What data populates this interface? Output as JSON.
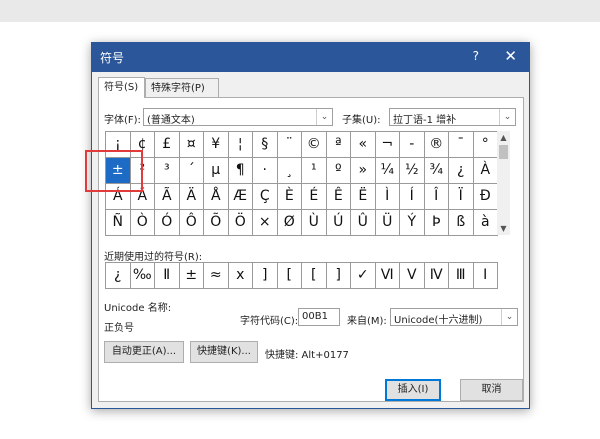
{
  "dialog": {
    "title": "符号",
    "help": "?",
    "close": "✕"
  },
  "tabs": [
    {
      "label": "符号(S)",
      "active": true
    },
    {
      "label": "特殊字符(P)",
      "active": false
    }
  ],
  "font": {
    "label": "字体(F):",
    "value": "(普通文本)"
  },
  "subset": {
    "label": "子集(U):",
    "value": "拉丁语-1 增补"
  },
  "symbol_rows": [
    [
      "¡",
      "¢",
      "£",
      "¤",
      "¥",
      "¦",
      "§",
      "¨",
      "©",
      "ª",
      "«",
      "¬",
      "-",
      "®",
      "¯",
      "°"
    ],
    [
      "±",
      "²",
      "³",
      "´",
      "µ",
      "¶",
      "·",
      "¸",
      "¹",
      "º",
      "»",
      "¼",
      "½",
      "¾",
      "¿",
      "À"
    ],
    [
      "Á",
      "Â",
      "Ã",
      "Ä",
      "Å",
      "Æ",
      "Ç",
      "È",
      "É",
      "Ê",
      "Ë",
      "Ì",
      "Í",
      "Î",
      "Ï",
      "Ð"
    ],
    [
      "Ñ",
      "Ò",
      "Ó",
      "Ô",
      "Õ",
      "Ö",
      "×",
      "Ø",
      "Ù",
      "Ú",
      "Û",
      "Ü",
      "Ý",
      "Þ",
      "ß",
      "à"
    ]
  ],
  "selected_symbol": "±",
  "recent": {
    "label": "近期使用过的符号(R):",
    "symbols": [
      "¿",
      "‰",
      "Ⅱ",
      "±",
      "≈",
      "x",
      "]",
      "[",
      "[",
      "]",
      "✓",
      "Ⅵ",
      "Ⅴ",
      "Ⅳ",
      "Ⅲ",
      "Ⅰ"
    ]
  },
  "unicode_name": {
    "label": "Unicode 名称:",
    "value": "正负号"
  },
  "char_code": {
    "label": "字符代码(C):",
    "value": "00B1"
  },
  "from": {
    "label": "来自(M):",
    "value": "Unicode(十六进制)"
  },
  "buttons": {
    "autocorrect": "自动更正(A)...",
    "shortcut_key": "快捷键(K)...",
    "insert": "插入(I)",
    "cancel": "取消"
  },
  "shortcut_text": "快捷键: Alt+0177",
  "colors": {
    "title_bar": "#2b579a",
    "selected_cell": "#1e6bc6",
    "highlight_box": "#e23b3b"
  }
}
